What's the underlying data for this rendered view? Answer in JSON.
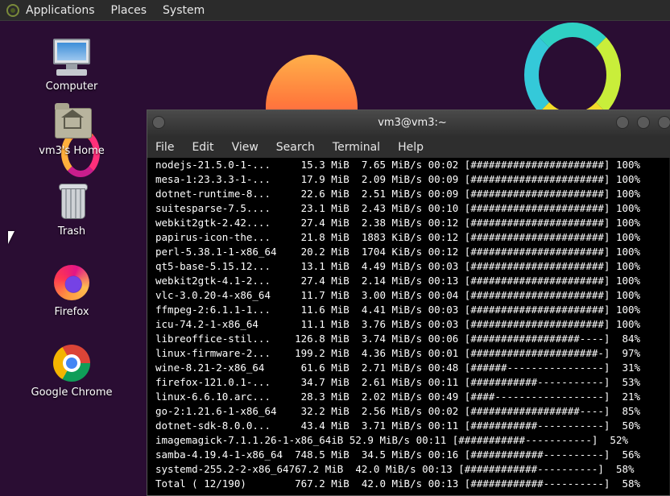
{
  "panel": {
    "menus": [
      "Applications",
      "Places",
      "System"
    ]
  },
  "desktop": {
    "icons": [
      {
        "label": "Computer",
        "icon": "computer-icon"
      },
      {
        "label": "vm3's Home",
        "icon": "home-folder-icon"
      },
      {
        "label": "Trash",
        "icon": "trash-icon"
      },
      {
        "label": "Firefox",
        "icon": "firefox-icon"
      },
      {
        "label": "Google Chrome",
        "icon": "chrome-icon"
      }
    ]
  },
  "terminal": {
    "title": "vm3@vm3:~",
    "menus": [
      "File",
      "Edit",
      "View",
      "Search",
      "Terminal",
      "Help"
    ],
    "lines": [
      "nodejs-21.5.0-1-...     15.3 MiB  7.65 MiB/s 00:02 [######################] 100%",
      "mesa-1:23.3.3-1-...     17.9 MiB  2.09 MiB/s 00:09 [######################] 100%",
      "dotnet-runtime-8...     22.6 MiB  2.51 MiB/s 00:09 [######################] 100%",
      "suitesparse-7.5....     23.1 MiB  2.43 MiB/s 00:10 [######################] 100%",
      "webkit2gtk-2.42....     27.4 MiB  2.38 MiB/s 00:12 [######################] 100%",
      "papirus-icon-the...     21.8 MiB  1883 KiB/s 00:12 [######################] 100%",
      "perl-5.38.1-1-x86_64    20.2 MiB  1704 KiB/s 00:12 [######################] 100%",
      "qt5-base-5.15.12...     13.1 MiB  4.49 MiB/s 00:03 [######################] 100%",
      "webkit2gtk-4.1-2...     27.4 MiB  2.14 MiB/s 00:13 [######################] 100%",
      "vlc-3.0.20-4-x86_64     11.7 MiB  3.00 MiB/s 00:04 [######################] 100%",
      "ffmpeg-2:6.1.1-1...     11.6 MiB  4.41 MiB/s 00:03 [######################] 100%",
      "icu-74.2-1-x86_64       11.1 MiB  3.76 MiB/s 00:03 [######################] 100%",
      "libreoffice-stil...    126.8 MiB  3.74 MiB/s 00:06 [##################----]  84%",
      "linux-firmware-2...    199.2 MiB  4.36 MiB/s 00:01 [#####################-]  97%",
      "wine-8.21-2-x86_64      61.6 MiB  2.71 MiB/s 00:48 [######----------------]  31%",
      "firefox-121.0.1-...     34.7 MiB  2.61 MiB/s 00:11 [###########-----------]  53%",
      "linux-6.6.10.arc...     28.3 MiB  2.02 MiB/s 00:49 [####------------------]  21%",
      "go-2:1.21.6-1-x86_64    32.2 MiB  2.56 MiB/s 00:02 [##################----]  85%",
      "dotnet-sdk-8.0.0...     43.4 MiB  3.71 MiB/s 00:11 [###########-----------]  50%",
      "imagemagick-7.1.1.26-1-x86_64iB 52.9 MiB/s 00:11 [###########-----------]  52%",
      "samba-4.19.4-1-x86_64  748.5 MiB  34.5 MiB/s 00:16 [############----------]  56%",
      "systemd-255.2-2-x86_64767.2 MiB  42.0 MiB/s 00:13 [############----------]  58%",
      "Total ( 12/190)        767.2 MiB  42.0 MiB/s 00:13 [############----------]  58%"
    ]
  }
}
